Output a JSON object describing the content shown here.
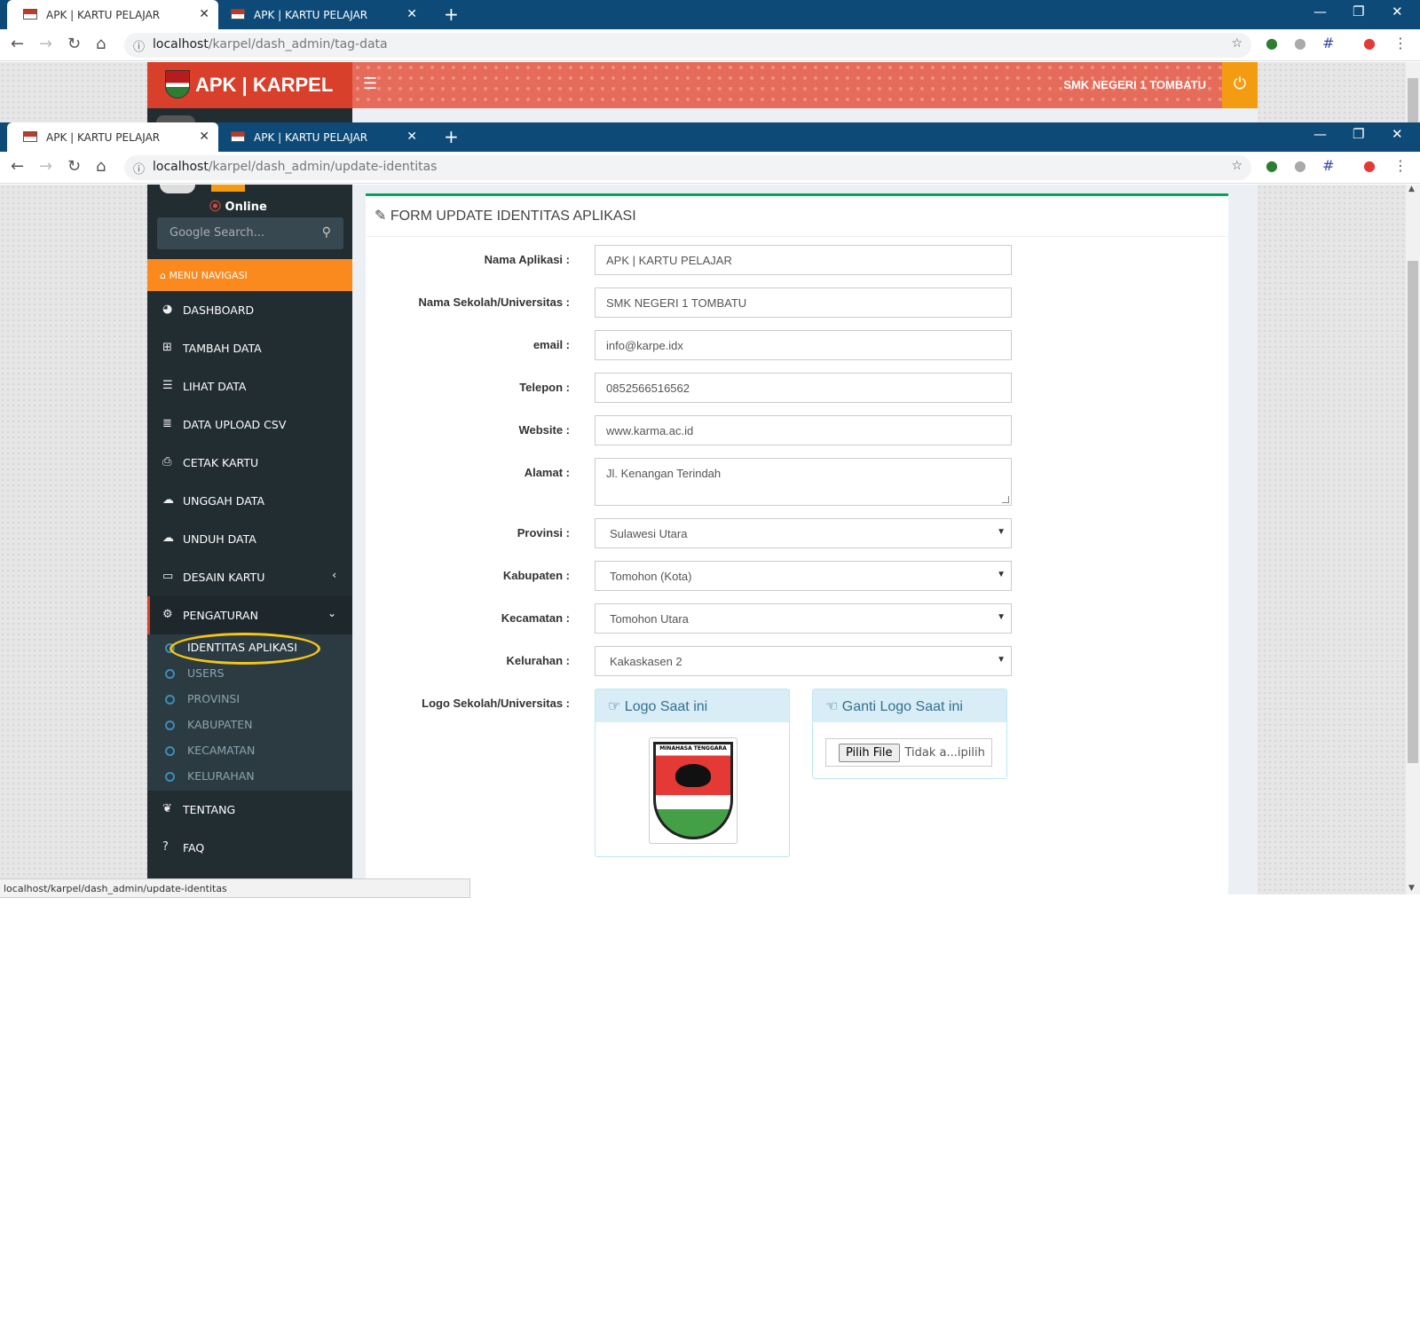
{
  "browser1": {
    "tabs": [
      {
        "label": "APK | KARTU PELAJAR"
      },
      {
        "label": "APK | KARTU PELAJAR"
      }
    ],
    "url_host": "localhost",
    "url_path": "/karpel/dash_admin/tag-data"
  },
  "browser2": {
    "tabs": [
      {
        "label": "APK | KARTU PELAJAR"
      },
      {
        "label": "APK | KARTU PELAJAR"
      }
    ],
    "url_host": "localhost",
    "url_path": "/karpel/dash_admin/update-identitas"
  },
  "header": {
    "brand": "APK | KARPEL",
    "school": "SMK NEGERI 1 TOMBATU"
  },
  "sidebar": {
    "status": "Online",
    "search_placeholder": "Google Search...",
    "menu_heading": "MENU NAVIGASI",
    "items": [
      {
        "label": "DASHBOARD"
      },
      {
        "label": "TAMBAH DATA"
      },
      {
        "label": "LIHAT DATA"
      },
      {
        "label": "DATA UPLOAD CSV"
      },
      {
        "label": "CETAK KARTU"
      },
      {
        "label": "UNGGAH DATA"
      },
      {
        "label": "UNDUH DATA"
      },
      {
        "label": "DESAIN KARTU"
      },
      {
        "label": "PENGATURAN"
      }
    ],
    "sub_items": [
      {
        "label": "IDENTITAS APLIKASI"
      },
      {
        "label": "USERS"
      },
      {
        "label": "PROVINSI"
      },
      {
        "label": "KABUPATEN"
      },
      {
        "label": "KECAMATAN"
      },
      {
        "label": "KELURAHAN"
      }
    ],
    "tail_items": [
      {
        "label": "TENTANG"
      },
      {
        "label": "FAQ"
      }
    ]
  },
  "form": {
    "title": "FORM UPDATE IDENTITAS APLIKASI",
    "fields": [
      {
        "label": "Nama Aplikasi :",
        "value": "APK | KARTU PELAJAR"
      },
      {
        "label": "Nama Sekolah/Universitas :",
        "value": "SMK NEGERI 1 TOMBATU"
      },
      {
        "label": "email :",
        "value": "info@karpe.idx"
      },
      {
        "label": "Telepon :",
        "value": "0852566516562"
      },
      {
        "label": "Website :",
        "value": "www.karma.ac.id"
      },
      {
        "label": "Alamat :",
        "value": "Jl. Kenangan Terindah"
      },
      {
        "label": "Provinsi :",
        "value": "Sulawesi Utara"
      },
      {
        "label": "Kabupaten :",
        "value": "Tomohon (Kota)"
      },
      {
        "label": "Kecamatan :",
        "value": "Tomohon Utara"
      },
      {
        "label": "Kelurahan :",
        "value": "Kakaskasen 2"
      }
    ],
    "logo_label": "Logo Sekolah/Universitas :",
    "logo_current_title": "Logo Saat ini",
    "logo_change_title": "Ganti Logo Saat ini",
    "emblem_text": "MINAHASA TENGGARA",
    "file_button": "Pilih File",
    "file_status": "Tidak a...ipilih"
  },
  "status_bar": "localhost/karpel/dash_admin/update-identitas"
}
